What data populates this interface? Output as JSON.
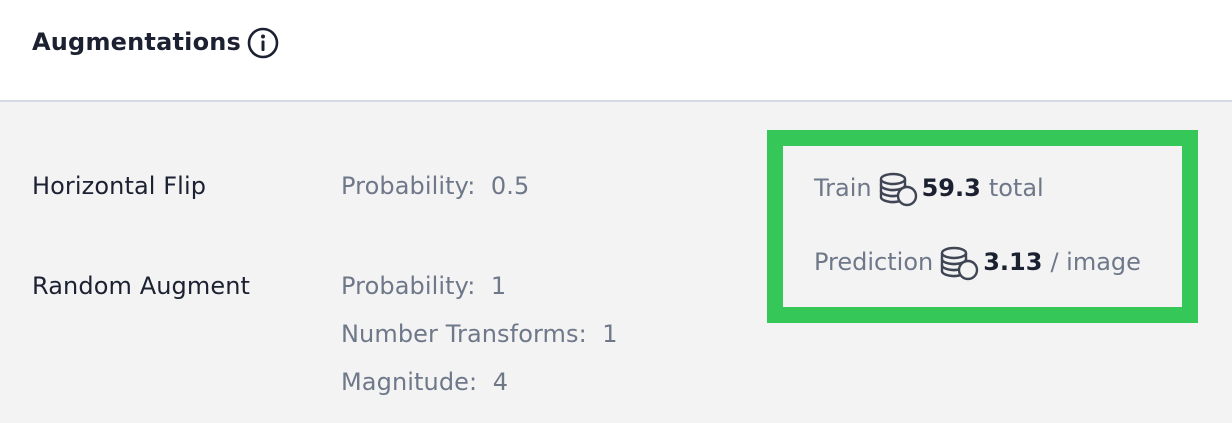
{
  "header": {
    "title": "Augmentations",
    "info_icon": "info-icon"
  },
  "augmentations": [
    {
      "name": "Horizontal Flip",
      "params": [
        "Probability:  0.5"
      ]
    },
    {
      "name": "Random Augment",
      "params": [
        "Probability:  1",
        "Number Transforms:  1",
        "Magnitude:  4"
      ]
    }
  ],
  "cost": {
    "highlight_color": "#35c757",
    "icon": "coins-icon",
    "train": {
      "label": "Train",
      "value": "59.3",
      "unit": "total"
    },
    "prediction": {
      "label": "Prediction",
      "value": "3.13",
      "unit": "/ image"
    }
  }
}
